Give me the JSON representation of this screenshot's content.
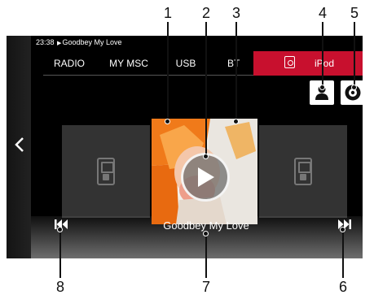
{
  "status_bar": {
    "time": "23:38",
    "now_playing": "Goodbey My Love"
  },
  "tabs": [
    {
      "label": "RADIO",
      "active": false
    },
    {
      "label": "MY MSC",
      "active": false
    },
    {
      "label": "USB",
      "active": false
    },
    {
      "label": "BT",
      "active": false
    },
    {
      "label": "iPod",
      "active": true
    }
  ],
  "buttons": {
    "back_icon": "chevron-left-icon",
    "artist_icon": "person-icon",
    "source_icon": "disc-icon",
    "play_icon": "play-icon",
    "prev_icon": "skip-previous-icon",
    "next_icon": "skip-next-icon"
  },
  "album": {
    "title": "Goodbey My Love"
  },
  "callouts": [
    "1",
    "2",
    "3",
    "4",
    "5",
    "6",
    "7",
    "8"
  ],
  "colors": {
    "accent": "#c8102e",
    "screen_bg": "#000000",
    "card_bg": "#333333"
  }
}
